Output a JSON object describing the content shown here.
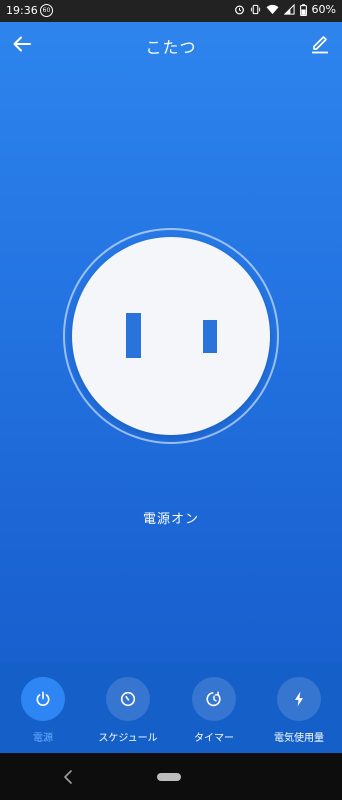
{
  "status_bar": {
    "time": "19:36",
    "badge": "60",
    "battery": "60%"
  },
  "header": {
    "title": "こたつ",
    "back_icon": "arrow-back-icon",
    "edit_icon": "pencil-icon"
  },
  "device": {
    "status": "電源オン",
    "outlet_color": "#2a73db"
  },
  "tabs": [
    {
      "label": "電源",
      "icon": "power-icon",
      "active": true
    },
    {
      "label": "スケジュール",
      "icon": "clock-icon",
      "active": false
    },
    {
      "label": "タイマー",
      "icon": "timer-icon",
      "active": false
    },
    {
      "label": "電気使用量",
      "icon": "bolt-icon",
      "active": false
    }
  ],
  "colors": {
    "background": "#2475e3",
    "active_tab": "#2e86f5",
    "active_label": "#68acff"
  }
}
